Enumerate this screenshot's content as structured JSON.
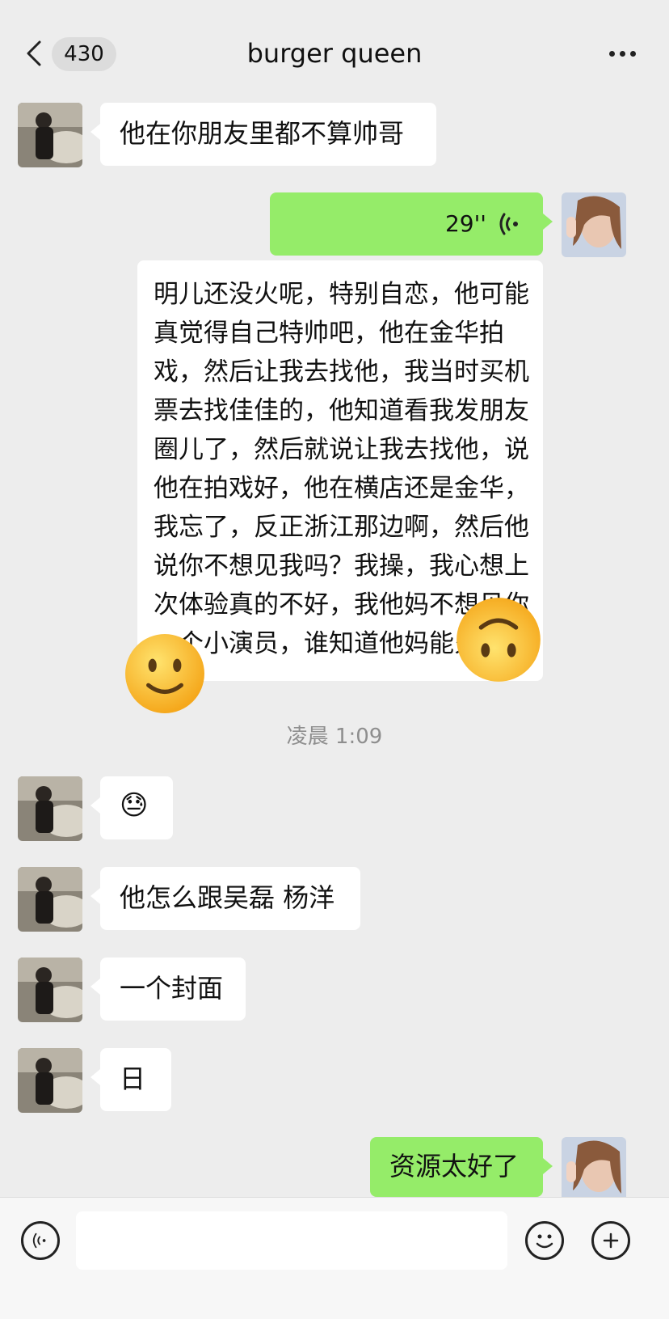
{
  "header": {
    "unread_count": "430",
    "chat_title": "burger queen"
  },
  "messages": [
    {
      "side": "in",
      "type": "text",
      "text": "他在你朋友里都不算帅哥"
    },
    {
      "side": "out",
      "type": "voice",
      "duration": "29''"
    },
    {
      "side": "out",
      "type": "voice_transcript",
      "text": "明儿还没火呢，特别自恋，他可能真觉得自己特帅吧，他在金华拍戏，然后让我去找他，我当时买机票去找佳佳的，他知道看我发朋友圈儿了，然后就说让我去找他，说他在拍戏好，他在横店还是金华，我忘了，反正浙江那边啊，然后他说你不想见我吗？我操，我心想上次体验真的不好，我他妈不想见你一个小演员，谁知道他妈能火了，"
    },
    {
      "type": "timestamp",
      "text": "凌晨 1:09"
    },
    {
      "side": "in",
      "type": "emoji",
      "text": "😓"
    },
    {
      "side": "in",
      "type": "text",
      "text": "他怎么跟吴磊 杨洋"
    },
    {
      "side": "in",
      "type": "text",
      "text": "一个封面"
    },
    {
      "side": "in",
      "type": "text",
      "text": "日"
    },
    {
      "side": "out",
      "type": "text",
      "text": "资源太好了"
    }
  ],
  "stickers": [
    "slightly-smiling-face",
    "upside-down-face"
  ],
  "colors": {
    "background": "#ededed",
    "outgoing_bubble": "#95ec69",
    "incoming_bubble": "#ffffff"
  }
}
